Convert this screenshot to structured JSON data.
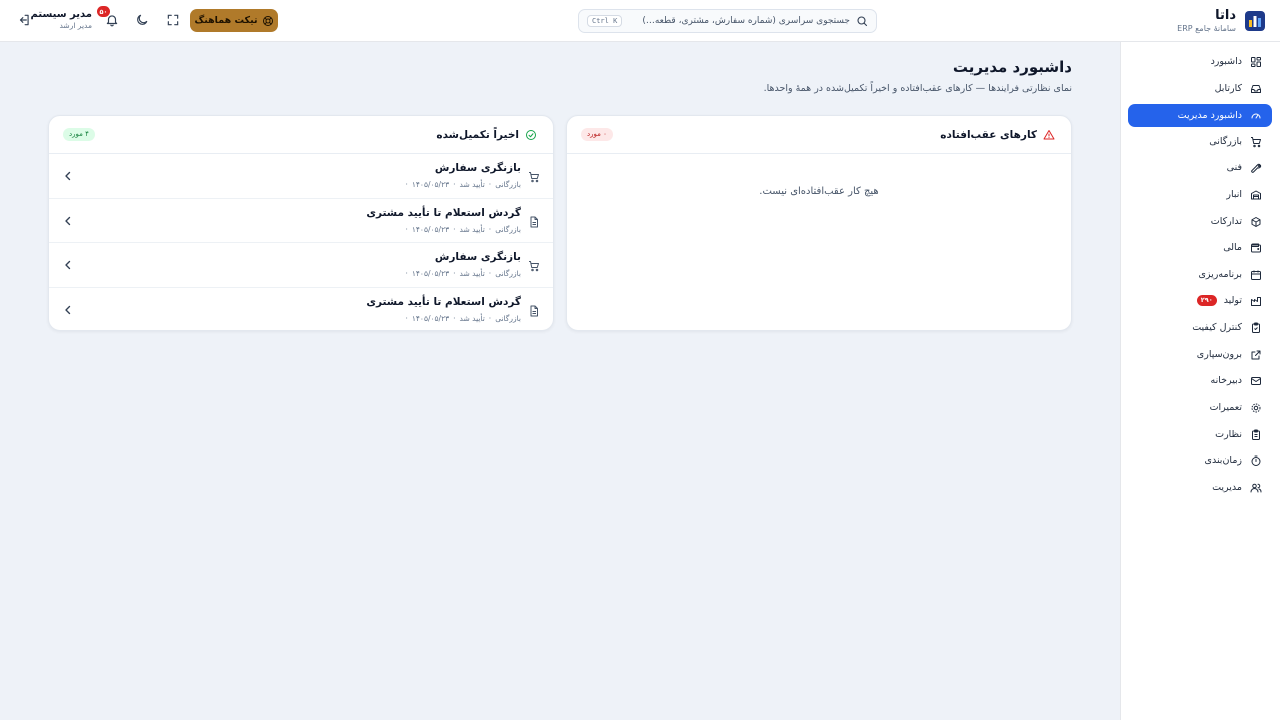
{
  "brand": {
    "name": "داتا",
    "subtitle": "سامانهٔ جامع ERP"
  },
  "search": {
    "placeholder": "جستجوی سراسری (شماره سفارش، مشتری، قطعه…)",
    "shortcut": "Ctrl K"
  },
  "header": {
    "ticket_label": "تیکت هماهنگ",
    "notification_count": "۵۰",
    "user_name": "مدیر سیستم",
    "user_role": "مدیر ارشد"
  },
  "sidebar": {
    "items": [
      {
        "label": "داشبورد",
        "icon": "dashboard-icon"
      },
      {
        "label": "کارتابل",
        "icon": "inbox-icon"
      },
      {
        "label": "داشبورد مدیریت",
        "icon": "gauge-icon",
        "active": true
      },
      {
        "label": "بازرگانی",
        "icon": "cart-icon"
      },
      {
        "label": "فنی",
        "icon": "wrench-icon"
      },
      {
        "label": "انبار",
        "icon": "warehouse-icon"
      },
      {
        "label": "تدارکات",
        "icon": "package-icon"
      },
      {
        "label": "مالی",
        "icon": "wallet-icon"
      },
      {
        "label": "برنامه‌ریزی",
        "icon": "calendar-icon"
      },
      {
        "label": "تولید",
        "icon": "factory-icon",
        "badge": "۲۹۰"
      },
      {
        "label": "کنترل کیفیت",
        "icon": "clipboard-check-icon"
      },
      {
        "label": "برون‌سپاری",
        "icon": "external-link-icon"
      },
      {
        "label": "دبیرخانه",
        "icon": "mail-icon"
      },
      {
        "label": "تعمیرات",
        "icon": "cog-icon"
      },
      {
        "label": "نظارت",
        "icon": "clipboard-list-icon"
      },
      {
        "label": "زمان‌بندی",
        "icon": "timer-icon"
      },
      {
        "label": "مدیریت",
        "icon": "users-icon"
      }
    ]
  },
  "page": {
    "title": "داشبورد مدیریت",
    "subtitle": "نمای نظارتی فرایندها — کارهای عقب‌افتاده و اخیراً تکمیل‌شده در همهٔ واحدها."
  },
  "overdue": {
    "title": "کارهای عقب‌افتاده",
    "count": "۰ مورد",
    "empty": "هیچ کار عقب‌افتاده‌ای نیست."
  },
  "completed": {
    "title": "اخیراً تکمیل‌شده",
    "count": "۴ مورد",
    "items": [
      {
        "title": "بازنگری سفارش",
        "unit": "بازرگانی",
        "status": "تأیید شد",
        "date": "۱۴۰۵/۰۵/۲۳",
        "icon": "cart-icon"
      },
      {
        "title": "گردش استعلام تا تأیید مشتری",
        "unit": "بازرگانی",
        "status": "تأیید شد",
        "date": "۱۴۰۵/۰۵/۲۳",
        "icon": "document-icon"
      },
      {
        "title": "بازنگری سفارش",
        "unit": "بازرگانی",
        "status": "تأیید شد",
        "date": "۱۴۰۵/۰۵/۲۳",
        "icon": "cart-icon"
      },
      {
        "title": "گردش استعلام تا تأیید مشتری",
        "unit": "بازرگانی",
        "status": "تأیید شد",
        "date": "۱۴۰۵/۰۵/۲۳",
        "icon": "document-icon"
      }
    ]
  },
  "colors": {
    "accent": "#2563eb",
    "ticket": "#b07a2a",
    "danger": "#dc2626",
    "success": "#16a34a",
    "background": "#eef2f8"
  }
}
